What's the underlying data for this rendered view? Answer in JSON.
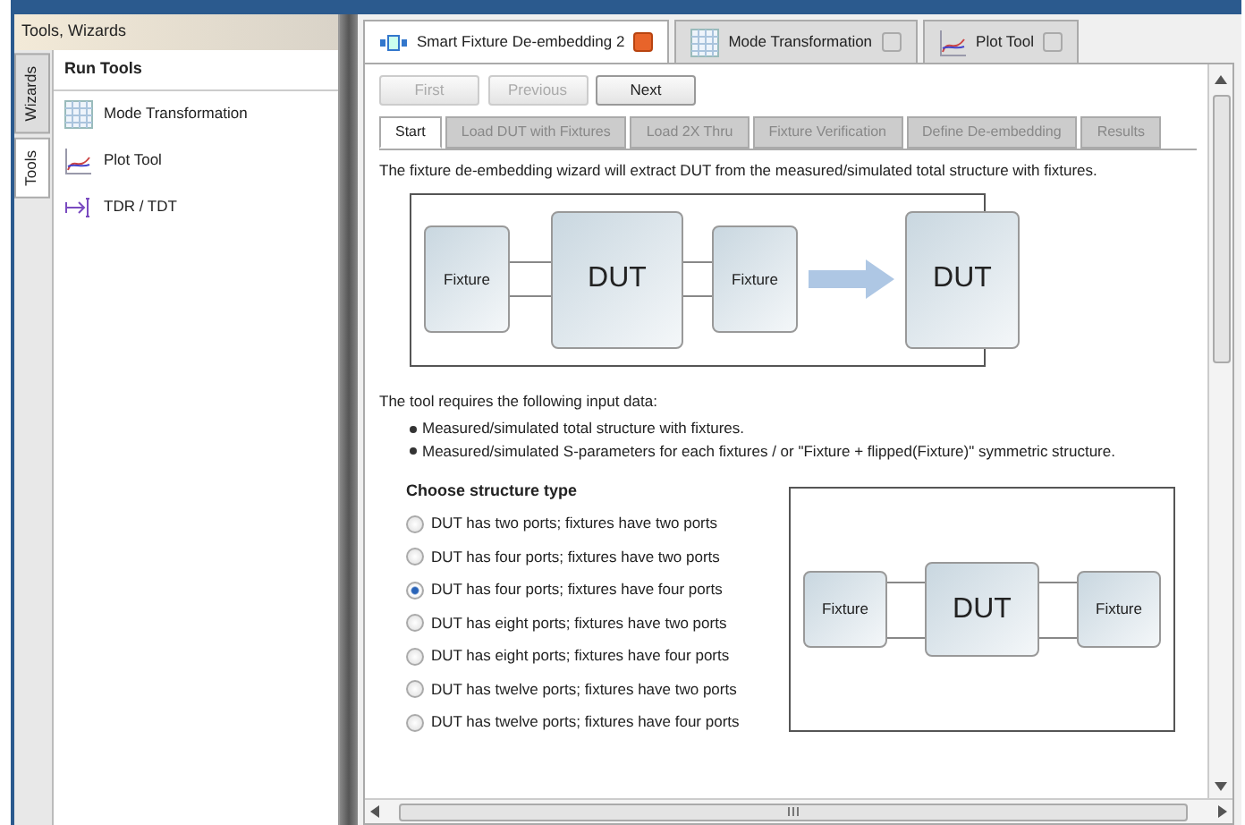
{
  "sidebar": {
    "title": "Tools, Wizards",
    "vertical_tabs": [
      {
        "label": "Wizards",
        "selected": false
      },
      {
        "label": "Tools",
        "selected": true
      }
    ],
    "section_title": "Run Tools",
    "items": [
      {
        "label": "Mode Transformation"
      },
      {
        "label": "Plot Tool"
      },
      {
        "label": "TDR / TDT"
      }
    ]
  },
  "document_tabs": [
    {
      "label": "Smart Fixture De-embedding 2",
      "selected": true
    },
    {
      "label": "Mode Transformation",
      "selected": false
    },
    {
      "label": "Plot Tool",
      "selected": false
    }
  ],
  "nav_buttons": [
    {
      "label": "First",
      "disabled": true
    },
    {
      "label": "Previous",
      "disabled": true
    },
    {
      "label": "Next",
      "disabled": false
    }
  ],
  "wizard_tabs": [
    {
      "label": "Start",
      "selected": true,
      "disabled": false
    },
    {
      "label": "Load DUT with Fixtures",
      "selected": false,
      "disabled": true
    },
    {
      "label": "Load 2X Thru",
      "selected": false,
      "disabled": true
    },
    {
      "label": "Fixture Verification",
      "selected": false,
      "disabled": true
    },
    {
      "label": "Define De-embedding",
      "selected": false,
      "disabled": true
    },
    {
      "label": "Results",
      "selected": false,
      "disabled": true
    }
  ],
  "intro": "The fixture de-embedding wizard will extract DUT from the measured/simulated total structure with fixtures.",
  "overview_diagram": {
    "before": [
      "Fixture",
      "DUT",
      "Fixture"
    ],
    "after": "DUT"
  },
  "requirements_title": "The tool requires the following input data:",
  "requirements": [
    "Measured/simulated total structure with fixtures.",
    "Measured/simulated S-parameters for each fixtures / or \"Fixture + flipped(Fixture)\" symmetric structure."
  ],
  "structure": {
    "title": "Choose structure type",
    "options": [
      {
        "label": "DUT has two ports; fixtures have two ports",
        "selected": false
      },
      {
        "label": "DUT has four ports; fixtures have two ports",
        "selected": false
      },
      {
        "label": "DUT has four ports; fixtures have four ports",
        "selected": true
      },
      {
        "label": "DUT has eight ports; fixtures have two ports",
        "selected": false
      },
      {
        "label": "DUT has eight ports; fixtures have four ports",
        "selected": false
      },
      {
        "label": "DUT has twelve ports; fixtures have two ports",
        "selected": false
      },
      {
        "label": "DUT has twelve ports; fixtures have four ports",
        "selected": false
      }
    ],
    "diagram": [
      "Fixture",
      "DUT",
      "Fixture"
    ]
  }
}
